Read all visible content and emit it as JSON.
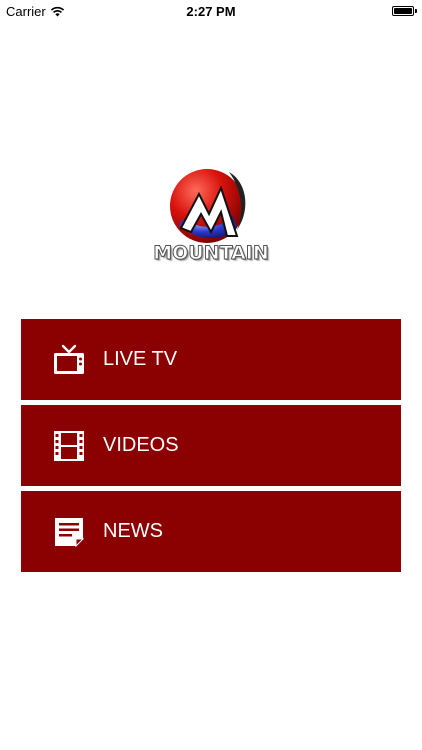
{
  "status_bar": {
    "carrier": "Carrier",
    "time": "2:27 PM",
    "battery_level": 1.0
  },
  "logo": {
    "text": "MOUNTAIN"
  },
  "menu": {
    "items": [
      {
        "label": "LIVE TV",
        "icon": "tv-icon"
      },
      {
        "label": "VIDEOS",
        "icon": "film-icon"
      },
      {
        "label": "NEWS",
        "icon": "news-icon"
      }
    ]
  },
  "colors": {
    "menu_background": "#8b0000",
    "menu_text": "#ffffff",
    "page_background": "#ffffff"
  }
}
